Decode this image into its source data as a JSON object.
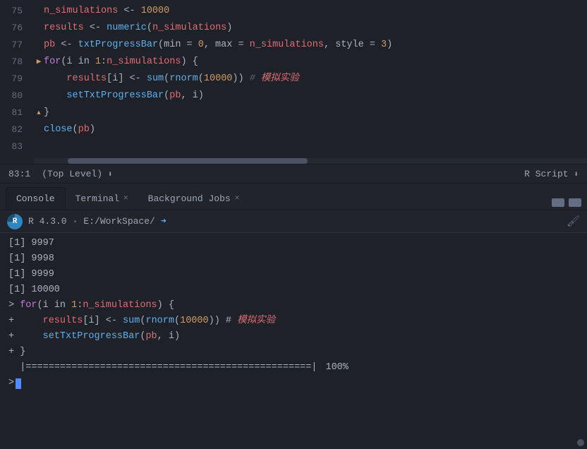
{
  "editor": {
    "lines": [
      {
        "num": "75",
        "marker": "",
        "content": "n_simulations <- 10000"
      },
      {
        "num": "76",
        "marker": "",
        "content": "results <- numeric(n_simulations)"
      },
      {
        "num": "77",
        "marker": "",
        "content": "pb <- txtProgressBar(min = 0, max = n_simulations, style = 3)"
      },
      {
        "num": "78",
        "marker": "▶",
        "content": "for(i in 1:n_simulations) {"
      },
      {
        "num": "79",
        "marker": "",
        "content": "    results[i] <- sum(rnorm(10000)) # 模拟实验"
      },
      {
        "num": "80",
        "marker": "",
        "content": "    setTxtProgressBar(pb, i)"
      },
      {
        "num": "81",
        "marker": "▲",
        "content": "}"
      },
      {
        "num": "82",
        "marker": "",
        "content": "close(pb)"
      },
      {
        "num": "83",
        "marker": "",
        "content": ""
      }
    ],
    "statusBar": {
      "position": "83:1",
      "level": "(Top Level)",
      "fileType": "R Script"
    }
  },
  "panel": {
    "tabs": [
      {
        "label": "Console",
        "closable": false,
        "active": true
      },
      {
        "label": "Terminal",
        "closable": true,
        "active": false
      },
      {
        "label": "Background Jobs",
        "closable": true,
        "active": false
      }
    ],
    "consoleHeader": {
      "version": "R 4.3.0",
      "separator": "·",
      "path": "E:/WorkSpace/",
      "arrowChar": "➜"
    },
    "outputLines": [
      {
        "type": "bracket",
        "text": "[1] 9997"
      },
      {
        "type": "bracket",
        "text": "[1] 9998"
      },
      {
        "type": "bracket",
        "text": "[1] 9999"
      },
      {
        "type": "bracket",
        "text": "[1] 10000"
      },
      {
        "type": "cmd",
        "prefix": "> ",
        "text": "for(i in 1:n_simulations) {"
      },
      {
        "type": "cont",
        "prefix": "+     ",
        "text": "results[i] <- sum(rnorm(10000)) # 模拟实验"
      },
      {
        "type": "cont",
        "prefix": "+     ",
        "text": "setTxtProgressBar(pb, i)"
      },
      {
        "type": "cont",
        "prefix": "+ ",
        "text": "}"
      }
    ],
    "progressBar": {
      "bar": "|==================================================|",
      "percent": "100%"
    },
    "cursor": {
      "prompt": ">"
    }
  }
}
